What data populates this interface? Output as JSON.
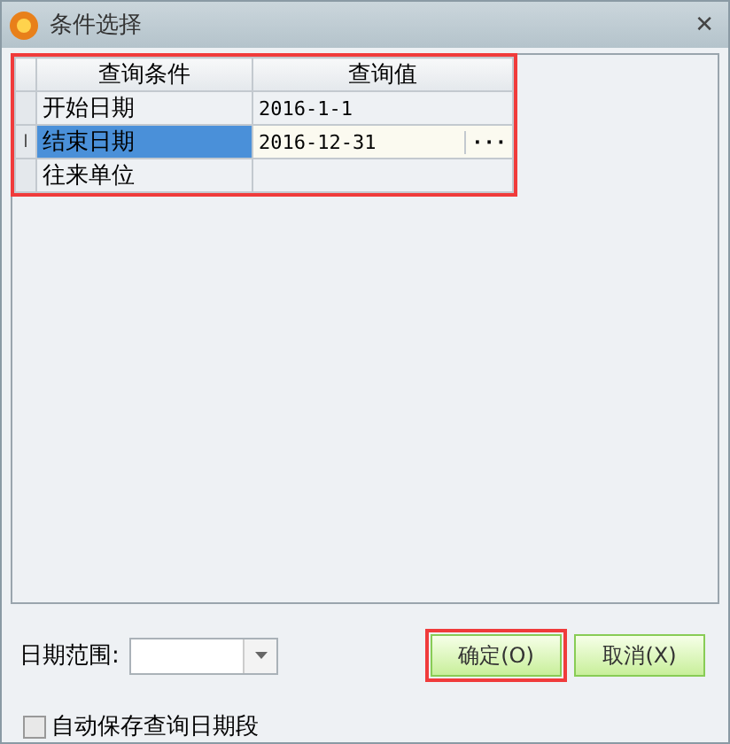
{
  "window": {
    "title": "条件选择",
    "close": "✕"
  },
  "grid": {
    "highlight": true,
    "columns": [
      "查询条件",
      "查询值"
    ],
    "rows": [
      {
        "condition": "开始日期",
        "value": "2016-1-1",
        "selected": false,
        "editing": false
      },
      {
        "condition": "结束日期",
        "value": "2016-12-31",
        "selected": true,
        "editing": true,
        "indicator": "I",
        "button": "···"
      },
      {
        "condition": "往来单位",
        "value": "",
        "selected": false,
        "editing": false
      }
    ]
  },
  "date_range": {
    "label": "日期范围:"
  },
  "buttons": [
    {
      "label": "确定(O)",
      "highlight": true
    },
    {
      "label": "取消(X)",
      "highlight": false
    }
  ],
  "auto_save": {
    "label": "自动保存查询日期段",
    "checked": false
  }
}
